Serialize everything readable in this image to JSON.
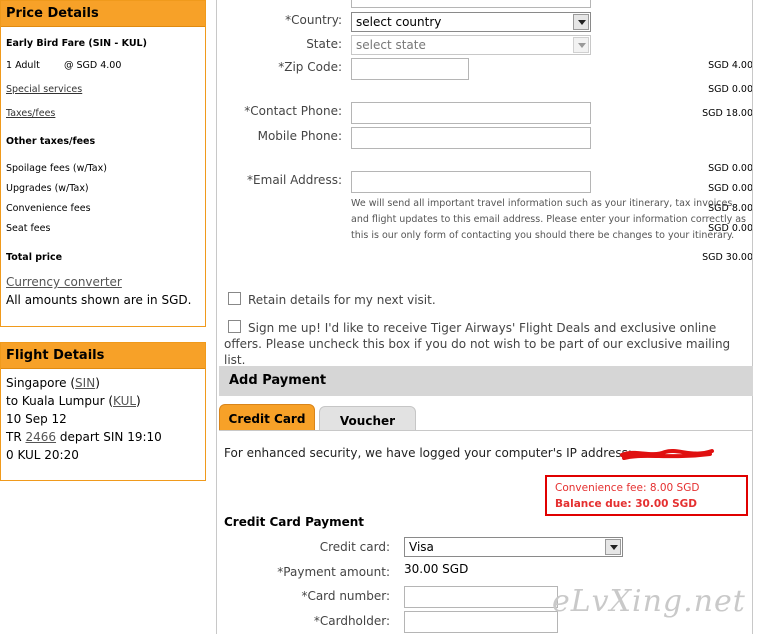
{
  "price_details": {
    "title": "Price Details",
    "fare_name": "Early Bird Fare (SIN - KUL)",
    "adult_label": "1 Adult",
    "adult_rate": "@ SGD  4.00",
    "adult_total": "SGD  4.00",
    "special_services_label": "Special services",
    "special_services_value": "SGD  0.00",
    "taxes_label": "Taxes/fees",
    "taxes_value": "SGD  18.00",
    "other_taxes_heading": "Other taxes/fees",
    "fees": [
      {
        "label": "Spoilage fees (w/Tax)",
        "value": "SGD  0.00"
      },
      {
        "label": "Upgrades (w/Tax)",
        "value": "SGD  0.00"
      },
      {
        "label": "Convenience fees",
        "value": "SGD  8.00"
      },
      {
        "label": "Seat fees",
        "value": "SGD  0.00"
      }
    ],
    "total_label": "Total price",
    "total_value": "SGD  30.00",
    "currency_converter": "Currency converter",
    "amounts_note": "All amounts shown are in SGD."
  },
  "flight_details": {
    "title": "Flight Details",
    "origin_city": "Singapore (",
    "origin_code": "SIN",
    "origin_close": ")",
    "dest_prefix": "to Kuala Lumpur (",
    "dest_code": "KUL",
    "dest_close": ")",
    "date": "10 Sep 12",
    "flight_prefix": "TR ",
    "flight_number": "2466",
    "depart_text": " depart SIN 19:10",
    "arrive_text": "0 KUL 20:20"
  },
  "form": {
    "country_label": "*Country:",
    "country_value": "select country",
    "state_label": "State:",
    "state_value": "select state",
    "zip_label": "*Zip Code:",
    "contact_phone_label": "*Contact Phone:",
    "mobile_phone_label": "Mobile Phone:",
    "email_label": "*Email Address:",
    "email_note": "We will send all important travel information such as your itinerary, tax invoices and flight updates to this email address. Please enter your information correctly as this is our only form of contacting you should there be changes to your itinerary.",
    "retain_label": "Retain details for my next visit.",
    "signup_label": "Sign me up! I'd like to receive Tiger Airways' Flight Deals and exclusive online offers. Please uncheck this box if you do not wish to be part of our exclusive mailing list."
  },
  "payment": {
    "section_title": "Add Payment",
    "tabs": [
      {
        "label": "Credit Card"
      },
      {
        "label": "Voucher"
      }
    ],
    "security_text": "For enhanced security, we have logged your computer's IP address:",
    "convenience_fee": "Convenience fee: 8.00  SGD",
    "balance_due": "Balance due: 30.00  SGD",
    "cc_heading": "Credit Card Payment",
    "credit_card_label": "Credit card:",
    "credit_card_value": "Visa",
    "payment_amount_label": "*Payment amount:",
    "payment_amount_value": "30.00  SGD",
    "card_number_label": "*Card number:",
    "cardholder_label": "*Cardholder:"
  },
  "watermark": "eLvXing.net",
  "colors": {
    "panel_header": "#f7a128",
    "panel_border": "#f09a1c",
    "fee_red": "#e53030",
    "highlight_box": "#e00000"
  }
}
